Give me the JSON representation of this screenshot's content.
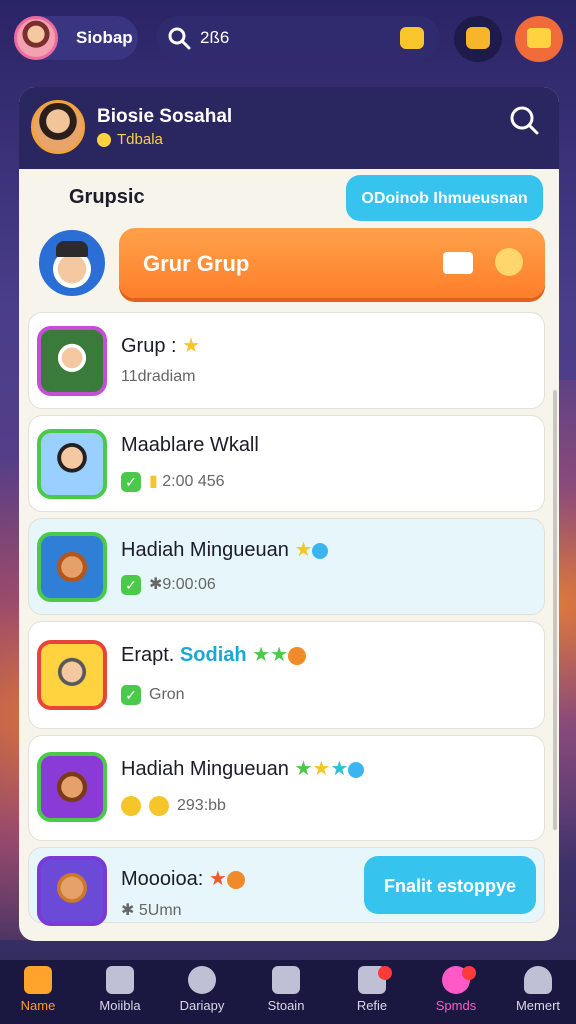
{
  "topbar": {
    "profile_name": "Siobap",
    "search_text": "2ß6",
    "icons": [
      "avatar",
      "search-icon",
      "chat-icon",
      "message-icon",
      "gift-icon"
    ]
  },
  "card": {
    "header_title": "Biosie Sosahal",
    "header_sub": "Tdbala",
    "section_title": "Grupsic",
    "section_button": "ODoinob Ihmueusnan",
    "cta_label": "Grur Grup"
  },
  "rows": [
    {
      "title": "Grup :",
      "meta": "11dradiam",
      "thumb_color": "#c44fd6"
    },
    {
      "title": "Maablare Wkall",
      "meta": "2:00 456",
      "thumb_color": "#4bc94b"
    },
    {
      "title": "Hadiah Mingueuan",
      "meta": "9:00:06",
      "thumb_color": "#4bc94b"
    },
    {
      "title": "Erapt.",
      "title_accent": "Sodiah",
      "meta": "Gron",
      "thumb_color": "#e8453a"
    },
    {
      "title": "Hadiah Mingueuan",
      "meta": "293:bb",
      "thumb_color": "#4bc94b"
    },
    {
      "title": "Moooioa:",
      "meta": "5Umn",
      "button": "Fnalit estoppye",
      "thumb_color": "#7a3ad6"
    }
  ],
  "nav": [
    {
      "label": "Name",
      "icon": "home-icon"
    },
    {
      "label": "Moiibla",
      "icon": "chart-icon"
    },
    {
      "label": "Dariapy",
      "icon": "timer-icon"
    },
    {
      "label": "Stoain",
      "icon": "star-icon"
    },
    {
      "label": "Refie",
      "icon": "calendar-icon"
    },
    {
      "label": "Spmds",
      "icon": "chat-icon"
    },
    {
      "label": "Memert",
      "icon": "person-icon"
    }
  ],
  "colors": {
    "accent": "#ff8a2a",
    "cyan": "#36c3ee",
    "dark": "#2a2660"
  }
}
